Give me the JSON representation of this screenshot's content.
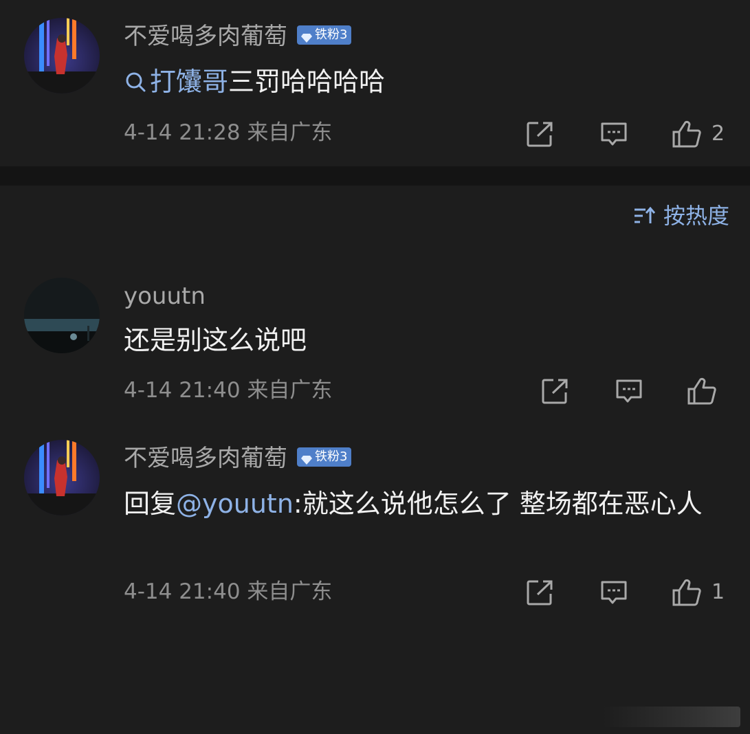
{
  "post": {
    "username": "不爱喝多肉葡萄",
    "badge": "铁粉3",
    "topic_link": "打馕哥",
    "content_rest": "三罚哈哈哈哈",
    "meta": "4-14 21:28 来自广东",
    "like_count": "2"
  },
  "sort": {
    "label": "按热度"
  },
  "comments": [
    {
      "username": "youutn",
      "content": "还是别这么说吧",
      "meta": "4-14 21:40 来自广东",
      "like_count": ""
    },
    {
      "username": "不爱喝多肉葡萄",
      "badge": "铁粉3",
      "reply_prefix": "回复",
      "mention": "@youutn",
      "content": ":就这么说他怎么了 整场都在恶心人",
      "meta": "4-14 21:40 来自广东",
      "like_count": "1"
    }
  ],
  "icons": {
    "search": "search-icon",
    "share": "share-icon",
    "comment": "comment-icon",
    "like": "thumbs-up-icon",
    "sort": "sort-icon",
    "badge_gem": "diamond-icon"
  },
  "colors": {
    "background": "#1d1d1d",
    "link": "#8eb2e6",
    "badge": "#4f7fc9",
    "muted_text": "#8e8e8e"
  }
}
